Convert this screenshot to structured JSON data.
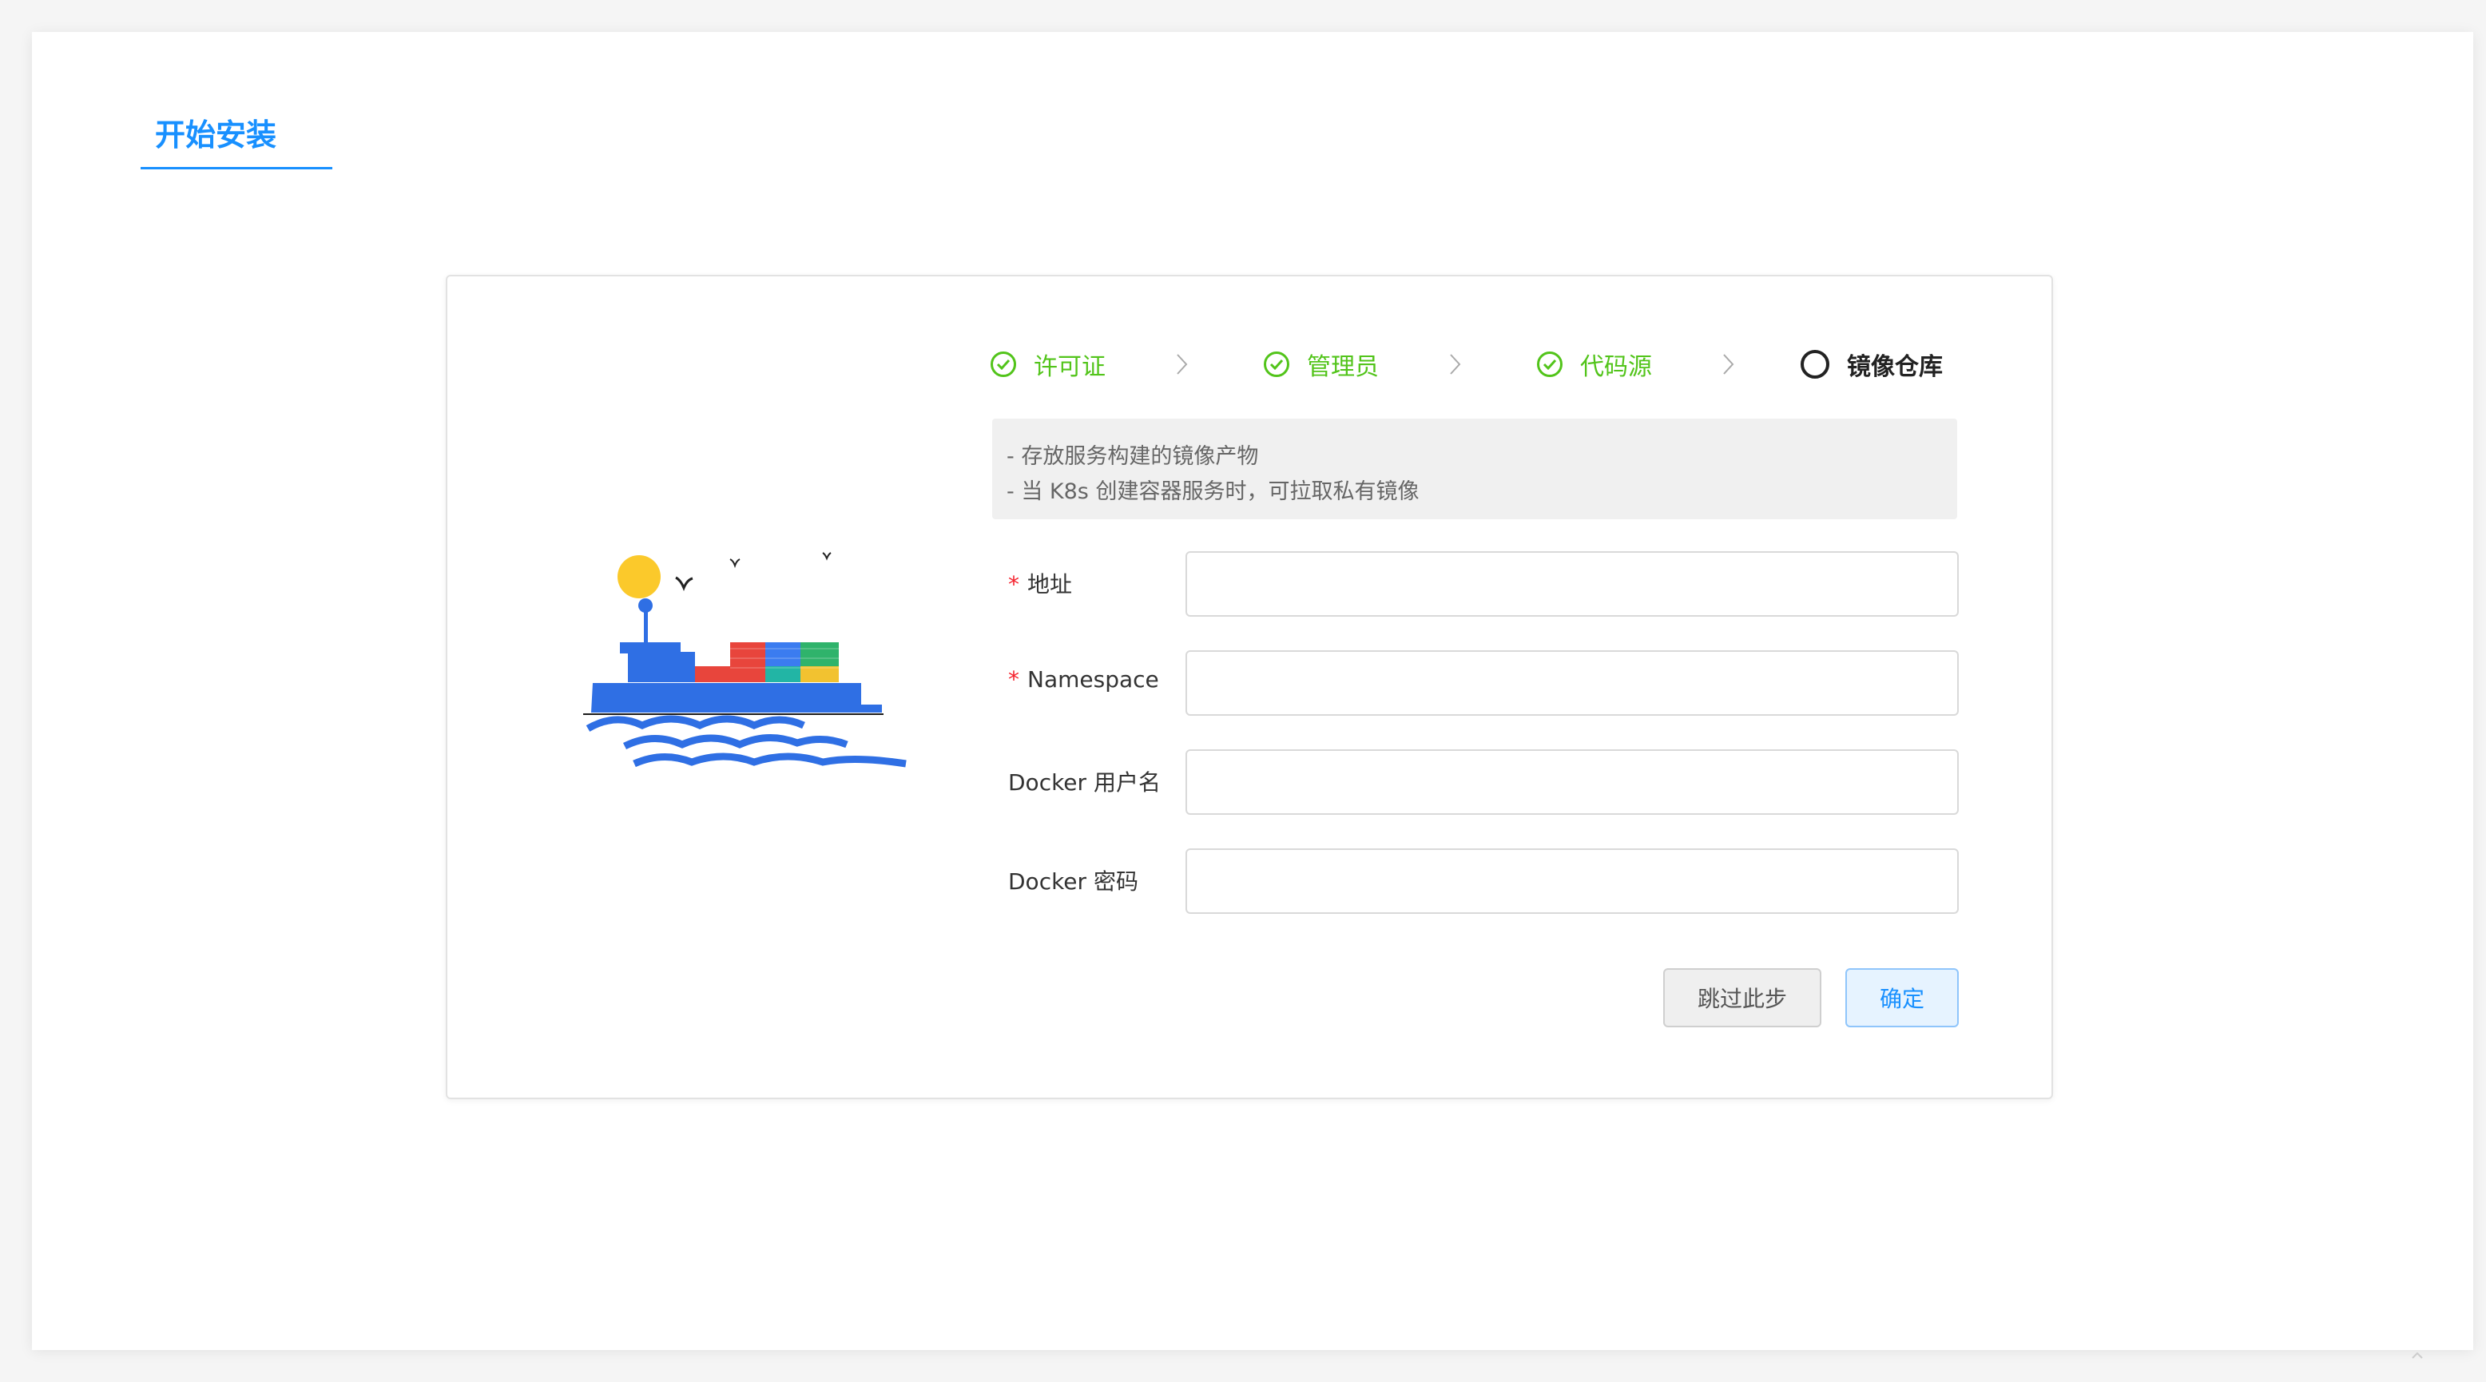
{
  "page": {
    "tab_title": "开始安装"
  },
  "steps": [
    {
      "label": "许可证",
      "status": "done"
    },
    {
      "label": "管理员",
      "status": "done"
    },
    {
      "label": "代码源",
      "status": "done"
    },
    {
      "label": "镜像仓库",
      "status": "current"
    }
  ],
  "info": {
    "lines": [
      "- 存放服务构建的镜像产物",
      "- 当 K8s 创建容器服务时，可拉取私有镜像"
    ]
  },
  "form": {
    "address": {
      "label": "地址",
      "required": true,
      "value": ""
    },
    "namespace": {
      "label": "Namespace",
      "required": true,
      "value": ""
    },
    "docker_username": {
      "label": "Docker 用户名",
      "required": false,
      "value": ""
    },
    "docker_password": {
      "label": "Docker 密码",
      "required": false,
      "value": ""
    }
  },
  "buttons": {
    "skip": "跳过此步",
    "confirm": "确定"
  },
  "colors": {
    "accent": "#1890ff",
    "success": "#52c41a",
    "required": "#f5222d",
    "ship": "#2f6fe4",
    "sun": "#fbc92b"
  },
  "icons": {
    "step_done": "check-circle-icon",
    "step_current": "circle-icon",
    "separator": "chevron-right-icon",
    "illustration": "container-ship-illustration"
  }
}
